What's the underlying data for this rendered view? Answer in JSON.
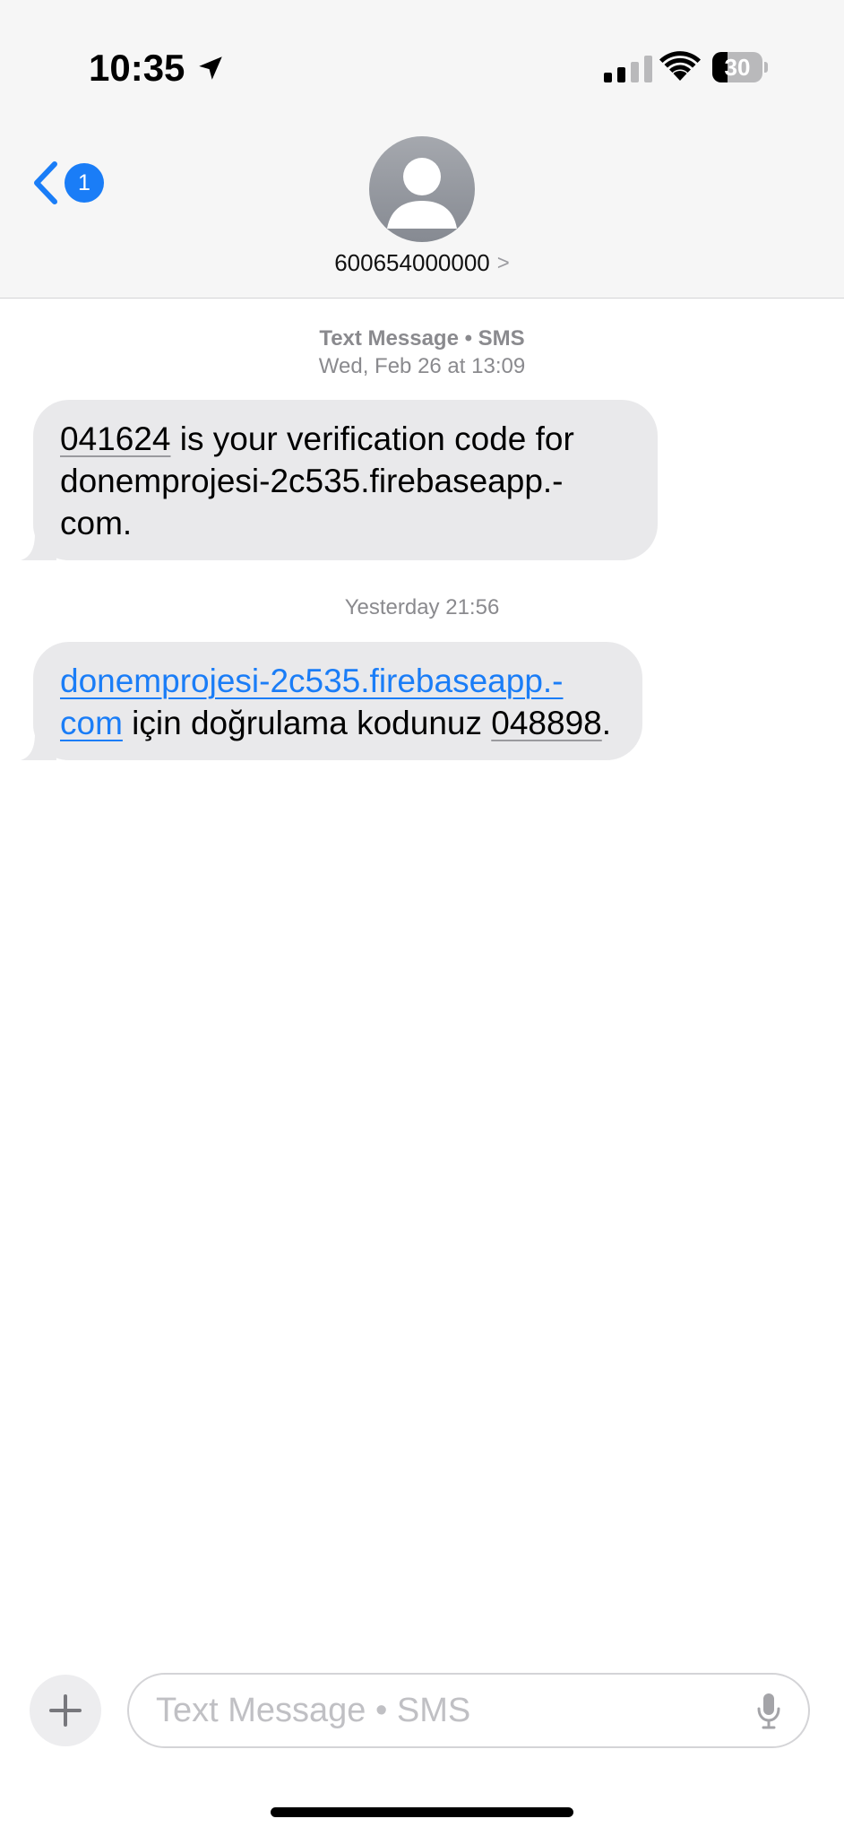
{
  "status_bar": {
    "time": "10:35",
    "battery_percent": "30",
    "battery_level": 0.3,
    "signal_bars_active": 2,
    "signal_bars_total": 4
  },
  "header": {
    "back_badge_count": "1",
    "contact_name": "600654000000",
    "contact_chevron": ">"
  },
  "conversation": {
    "first_meta": {
      "service": "Text Message • SMS",
      "date": "Wed, Feb 26 at 13:09"
    },
    "message_1": {
      "code": "041624",
      "text": " is your verification code for donemprojesi-2c535.firebaseapp.-com."
    },
    "second_meta": {
      "date": "Yesterday 21:56"
    },
    "message_2": {
      "link": "donemprojesi-2c535.firebaseapp.-com",
      "text_middle": " için doğrulama kodunuz ",
      "code": "048898",
      "text_end": "."
    }
  },
  "input_bar": {
    "placeholder": "Text Message • SMS"
  },
  "colors": {
    "accent": "#1a7df7",
    "bubble_incoming": "#e9e9eb",
    "meta_text": "#8a8a8e"
  },
  "icons": {
    "back": "chevron-left-icon",
    "location": "location-arrow-icon",
    "wifi": "wifi-icon",
    "avatar": "person-silhouette-icon",
    "plus": "plus-icon",
    "mic": "microphone-icon"
  }
}
